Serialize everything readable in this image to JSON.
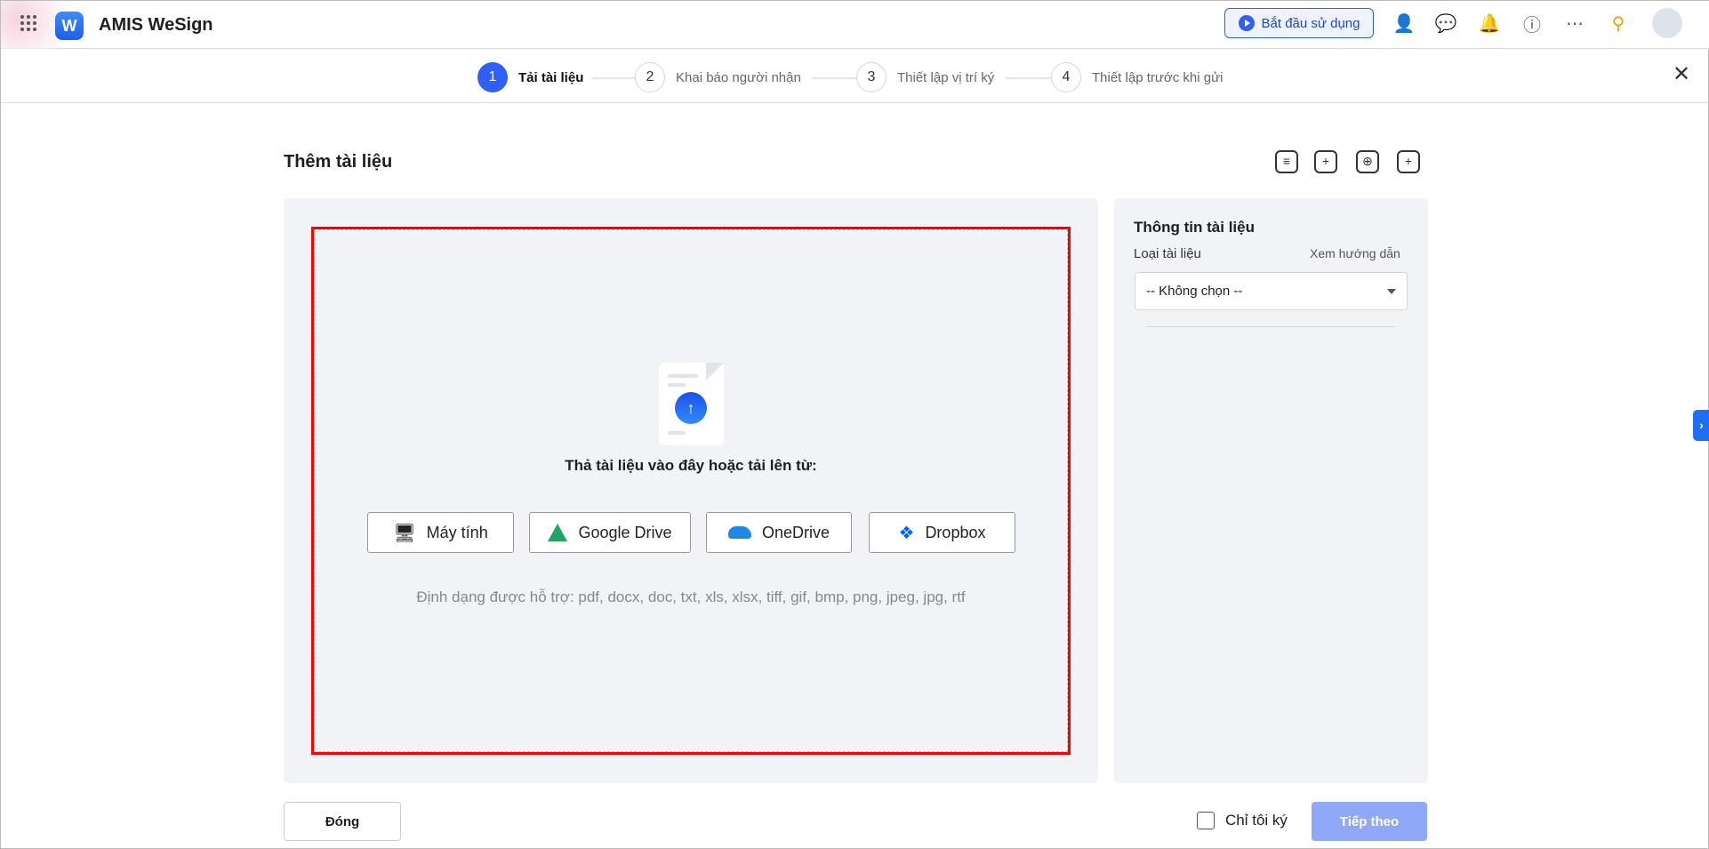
{
  "header": {
    "app_title": "AMIS WeSign",
    "logo_letter": "W",
    "start_label": "Bắt đầu sử dụng"
  },
  "steps": [
    {
      "num": "1",
      "label": "Tải tài liệu"
    },
    {
      "num": "2",
      "label": "Khai báo người nhận"
    },
    {
      "num": "3",
      "label": "Thiết lập vị trí ký"
    },
    {
      "num": "4",
      "label": "Thiết lập trước khi gửi"
    }
  ],
  "page_title": "Thêm tài liệu",
  "upload": {
    "drop_text": "Thả tài liệu vào đây hoặc tải lên từ:",
    "sources": [
      "Máy tính",
      "Google Drive",
      "OneDrive",
      "Dropbox"
    ],
    "formats": "Định dạng được hỗ trợ: pdf, docx, doc, txt, xls, xlsx, tiff, gif, bmp, png, jpeg, jpg, rtf"
  },
  "side": {
    "title": "Thông tin tài liệu",
    "type_label": "Loại tài liệu",
    "guide_link": "Xem hướng dẫn",
    "type_value": "-- Không chọn --"
  },
  "footer": {
    "close_label": "Đóng",
    "only_me_label": "Chỉ tôi ký",
    "only_me_checked": false,
    "next_label": "Tiếp theo"
  },
  "colors": {
    "accent": "#2f5ff5",
    "highlight": "#ff0000"
  }
}
